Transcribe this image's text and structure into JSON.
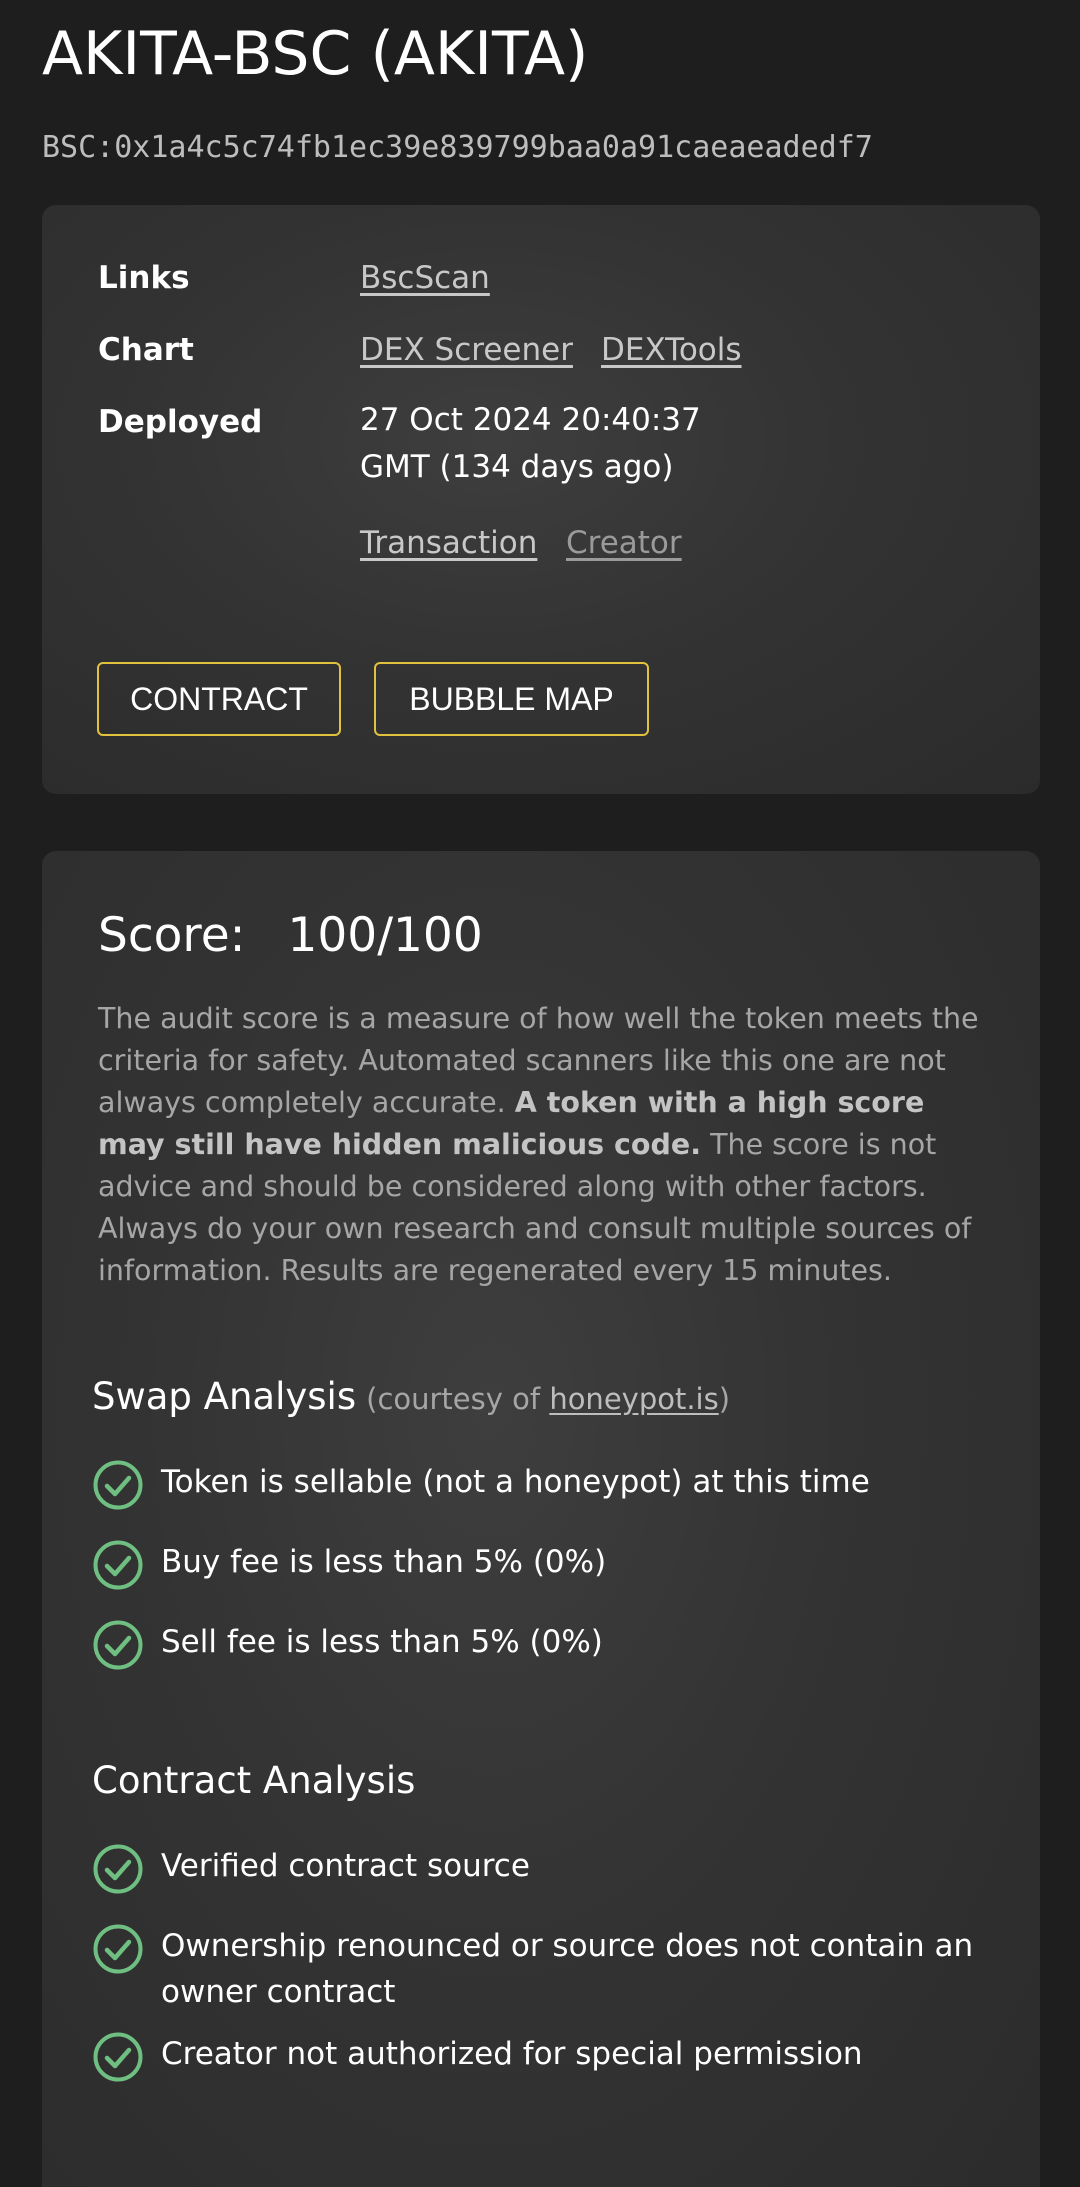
{
  "token": {
    "title": "AKITA-BSC (AKITA)",
    "address": "BSC:0x1a4c5c74fb1ec39e839799baa0a91caeaeadedf7"
  },
  "info": {
    "links_label": "Links",
    "bscscan_link": "BscScan",
    "chart_label": "Chart",
    "dexscreener_link": "DEX Screener",
    "dextools_link": "DEXTools",
    "deployed_label": "Deployed",
    "deployed_line1": "27 Oct 2024 20:40:37",
    "deployed_line2": "GMT (134 days ago)",
    "transaction_link": "Transaction",
    "creator_link": "Creator",
    "contract_button": "CONTRACT",
    "bubble_map_button": "BUBBLE MAP"
  },
  "score": {
    "label": "Score:",
    "value": "100/100",
    "desc_part1": "The audit score is a measure of how well the token meets the criteria for safety. Automated scanners like this one are not always completely accurate. ",
    "desc_bold": "A token with a high score may still have hidden malicious code.",
    "desc_part2": " The score is not advice and should be considered along with other factors. Always do your own research and consult multiple sources of information. Results are regenerated every 15 minutes."
  },
  "swap_analysis": {
    "title": "Swap Analysis",
    "courtesy_prefix": "(courtesy of ",
    "courtesy_link": "honeypot.is",
    "courtesy_suffix": ")",
    "items": [
      {
        "text": "Token is sellable (not a honeypot) at this time",
        "icon": "check-circle-icon"
      },
      {
        "text": "Buy fee is less than 5% (0%)",
        "icon": "check-circle-icon"
      },
      {
        "text": "Sell fee is less than 5% (0%)",
        "icon": "check-circle-icon"
      }
    ]
  },
  "contract_analysis": {
    "title": "Contract Analysis",
    "items": [
      {
        "text": "Verified contract source",
        "icon": "check-circle-icon"
      },
      {
        "text": "Ownership renounced or source does not contain an owner contract",
        "icon": "check-circle-icon"
      },
      {
        "text": "Creator not authorized for special permission",
        "icon": "check-circle-icon"
      }
    ]
  },
  "colors": {
    "background": "#1e1e1e",
    "card": "#333333",
    "button_border": "#e0c23c",
    "check_green": "#6fbf82",
    "muted_text": "#a6a6a6"
  }
}
